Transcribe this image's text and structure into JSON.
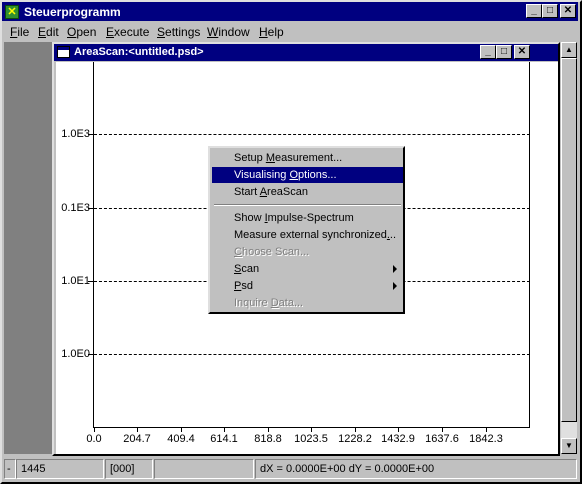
{
  "app": {
    "title": "Steuerprogramm"
  },
  "menubar": [
    {
      "pre": "",
      "ul": "F",
      "post": "ile"
    },
    {
      "pre": "",
      "ul": "E",
      "post": "dit"
    },
    {
      "pre": "",
      "ul": "O",
      "post": "pen"
    },
    {
      "pre": "",
      "ul": "E",
      "post": "xecute"
    },
    {
      "pre": "",
      "ul": "S",
      "post": "ettings"
    },
    {
      "pre": "",
      "ul": "W",
      "post": "indow"
    },
    {
      "pre": "",
      "ul": "H",
      "post": "elp"
    }
  ],
  "child": {
    "title": "AreaScan:<untitled.psd>"
  },
  "plot": {
    "y_labels": [
      "1.0E3",
      "0.1E3",
      "1.0E1",
      "1.0E0"
    ],
    "x_labels": [
      "0.0",
      "204.7",
      "409.4",
      "614.1",
      "818.8",
      "1023.5",
      "1228.2",
      "1432.9",
      "1637.6",
      "1842.3"
    ]
  },
  "context_menu": {
    "items": [
      {
        "pre": "Setup ",
        "ul": "M",
        "post": "easurement...",
        "state": "normal"
      },
      {
        "pre": "Visualising ",
        "ul": "O",
        "post": "ptions...",
        "state": "selected"
      },
      {
        "pre": "Start ",
        "ul": "A",
        "post": "reaScan",
        "state": "normal"
      },
      {
        "pre": "Show ",
        "ul": "I",
        "post": "mpulse-Spectrum",
        "state": "normal"
      },
      {
        "pre": "Measure external synchronized",
        "ul": ".",
        "post": "..",
        "state": "normal"
      },
      {
        "pre": "",
        "ul": "C",
        "post": "hoose Scan...",
        "state": "disabled"
      },
      {
        "pre": "",
        "ul": "S",
        "post": "can",
        "state": "normal",
        "submenu": true
      },
      {
        "pre": "",
        "ul": "P",
        "post": "sd",
        "state": "normal",
        "submenu": true
      },
      {
        "pre": "Inquire ",
        "ul": "D",
        "post": "ata...",
        "state": "disabled"
      }
    ]
  },
  "status": {
    "cell0": "-",
    "cell1": "1445",
    "cell2": "[000]",
    "cell3": "",
    "cell4": "dX = 0.0000E+00  dY = 0.0000E+00"
  }
}
